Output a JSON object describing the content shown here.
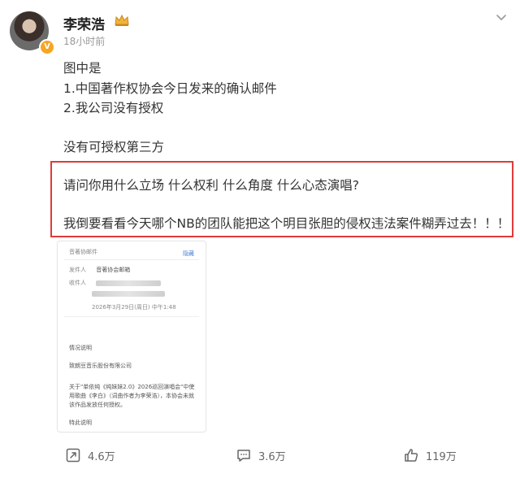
{
  "post": {
    "author": "李荣浩",
    "time": "18小时前",
    "lines": [
      "图中是",
      "1.中国著作权协会今日发来的确认邮件",
      "2.我公司没有授权",
      "没有可授权第三方"
    ],
    "highlight": [
      "请问你用什么立场 什么权利 什么角度 什么心态演唱?",
      "我倒要看看今天哪个NB的团队能把这个明目张胆的侵权违法案件糊弄过去！！！"
    ]
  },
  "email": {
    "subject": "音著协邮件",
    "reply_label": "隐藏",
    "sender_label": "发件人",
    "sender": "音著协会邮箱",
    "recipient_label": "收件人",
    "datetime": "2026年3月29日(周日) 中午1:48",
    "section_title": "情况说明",
    "addressee": "致朗豆音乐股份有限公司",
    "body": "关于\"单依纯《纯妹妹2.0》2026巡回演唱会\"中使用歌曲《李白》（词曲作者为李荣浩），本协会未就该作品发放任何授权。",
    "closing": "特此说明"
  },
  "actions": {
    "repost_count": "4.6万",
    "comment_count": "3.6万",
    "like_count": "119万"
  },
  "colors": {
    "highlight_border": "#e03a3a",
    "verified_badge": "#f5a623"
  }
}
